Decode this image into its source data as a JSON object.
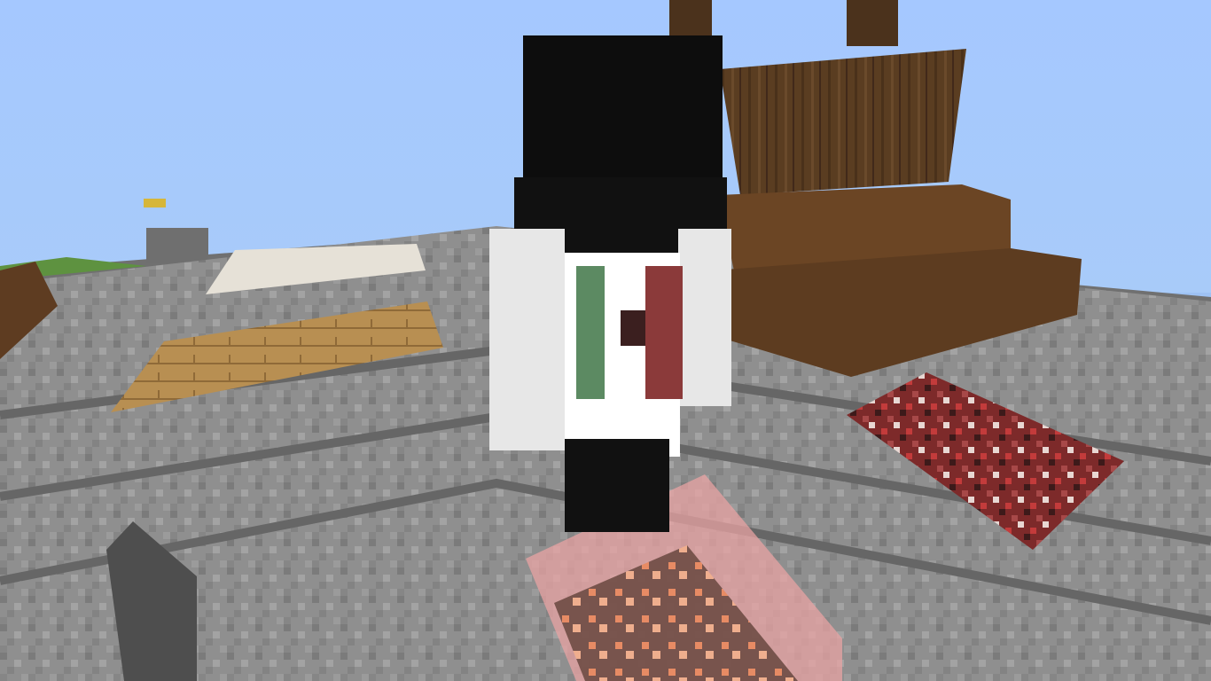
{
  "scene": {
    "game": "Minecraft",
    "view": "third-person",
    "blocks": [
      "stone-bricks",
      "oak-planks",
      "spruce-stairs",
      "spruce-log",
      "red-stained-glass",
      "copper-ore",
      "white-carpet",
      "red-terracotta-rug"
    ],
    "player": {
      "hair_color": "#0e0e0e",
      "shirt_color": "#e6e6e6",
      "scarf_colors": [
        "#5d8565",
        "#8b3b3b"
      ],
      "pants_color": "#111111"
    },
    "colors": {
      "sky": "#a5c8ff",
      "stone": "#8e8e8e",
      "stone_dark": "#6b6b6b",
      "planks": "#b58c52",
      "spruce": "#5c3e22",
      "glass_red": "#e59b9b"
    }
  }
}
